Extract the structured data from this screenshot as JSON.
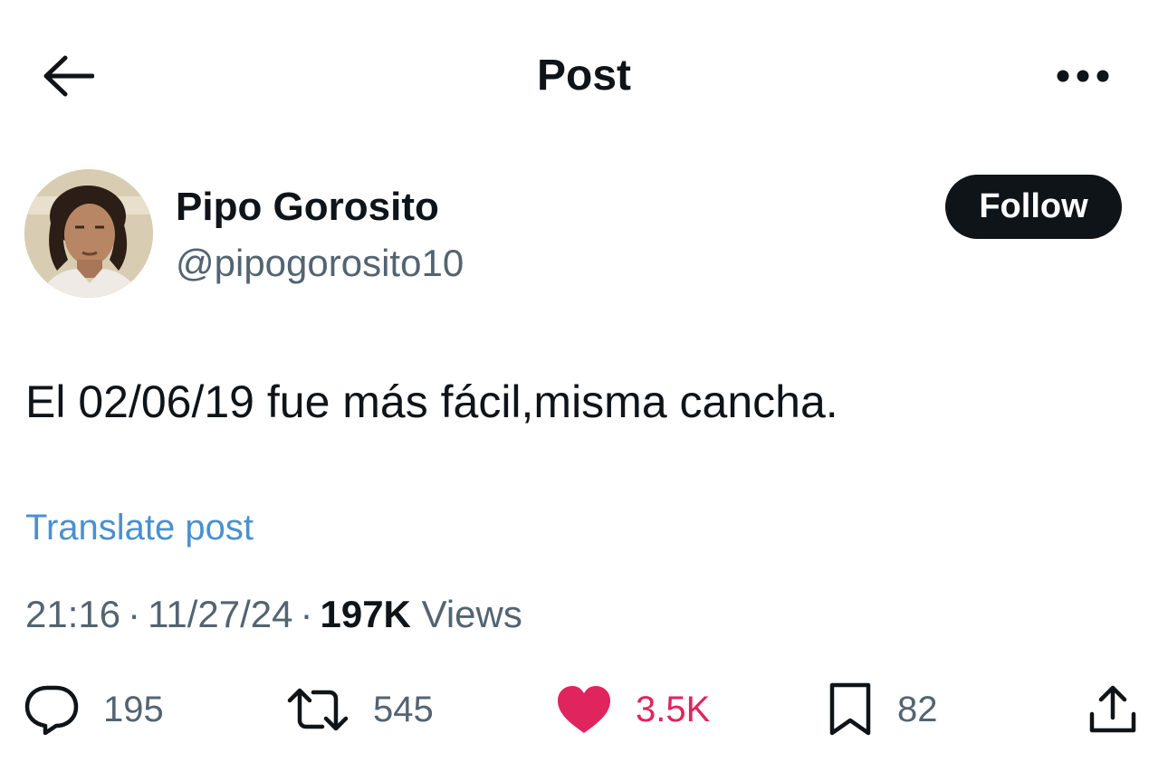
{
  "header": {
    "title": "Post",
    "back_icon": "arrow-left-icon",
    "more_icon": "more-horizontal-icon"
  },
  "author": {
    "name": "Pipo Gorosito",
    "handle": "@pipogorosito10",
    "follow_label": "Follow"
  },
  "post": {
    "text": "El 02/06/19 fue más fácil,misma cancha.",
    "translate_label": "Translate post",
    "time": "21:16",
    "date": "11/27/24",
    "separator": "·",
    "views_count": "197K",
    "views_label": "Views"
  },
  "actions": {
    "replies": "195",
    "reposts": "545",
    "likes": "3.5K",
    "bookmarks": "82"
  },
  "colors": {
    "text": "#0f1419",
    "secondary": "#536471",
    "link": "#4a90d0",
    "like": "#e0245e",
    "follow_bg": "#0f1419"
  }
}
